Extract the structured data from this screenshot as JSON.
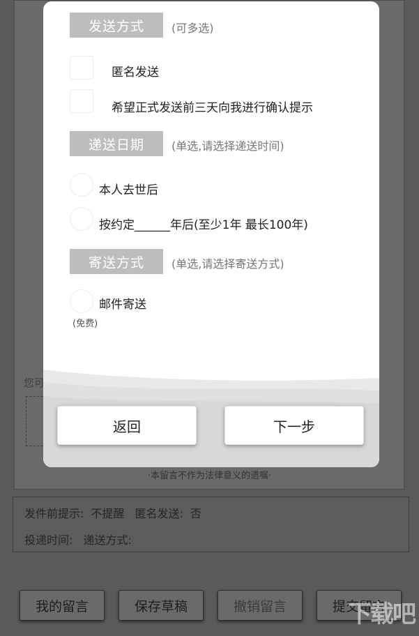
{
  "background": {
    "prompt_text": "您可",
    "legal_note": "·本留言不作为法律意义的遗嘱·",
    "info": {
      "pre_send_reminder_label": "发件前提示:",
      "pre_send_reminder_value": "不提醒",
      "anonymous_label": "匿名发送:",
      "anonymous_value": "否",
      "delivery_time_label": "投递时间:",
      "delivery_method_label": "递送方式:"
    },
    "buttons": {
      "my_messages": "我的留言",
      "save_draft": "保存草稿",
      "revoke_message": "撤销留言",
      "submit_message": "提交留言"
    },
    "watermark": "下载吧"
  },
  "modal": {
    "send_method": {
      "tag": "发送方式",
      "hint": "(可多选)",
      "options": [
        "匿名发送",
        "希望正式发送前三天向我进行确认提示"
      ]
    },
    "delivery_date": {
      "tag": "递送日期",
      "hint": "(单选,请选择递送时间)",
      "options": [
        "本人去世后",
        "按约定______年后(至少1年 最长100年)"
      ]
    },
    "mail_method": {
      "tag": "寄送方式",
      "hint": "(单选,请选择寄送方式)",
      "options": [
        "邮件寄送"
      ],
      "free_note": "(免费)"
    },
    "back_button": "返回",
    "next_button": "下一步"
  },
  "colors": {
    "section_tag_bg": "#bdbdbd",
    "overlay_bg": "#5a5a5a",
    "modal_bg": "#ffffff"
  }
}
